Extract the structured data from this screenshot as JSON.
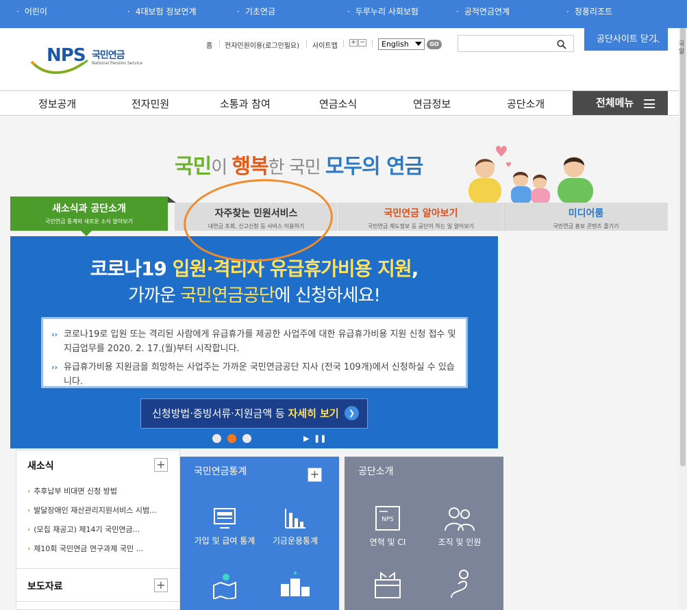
{
  "topbar": {
    "links": [
      "어린이",
      "4대보험 정보연계",
      "기초연금",
      "두루누리 사회보험",
      "공적연금연계",
      "청풍리조트"
    ]
  },
  "header": {
    "logo_brand": "NPS",
    "logo_name": "국민연금",
    "logo_sub": "National Pension Service",
    "util": {
      "home": "홈",
      "login": "전자민원이용(로그인필요)",
      "sitemap": "사이트맵",
      "zoom_in": "+",
      "zoom_out": "−"
    },
    "language": "English",
    "go_label": "GO",
    "search_placeholder": "",
    "close_sites_label": "공단사이트 닫기"
  },
  "side_cut_text": "국알",
  "gnb": {
    "items": [
      "정보공개",
      "전자민원",
      "소통과 참여",
      "연금소식",
      "연금정보",
      "공단소개"
    ],
    "all_menu_label": "전체메뉴"
  },
  "slogan": {
    "w1": "국민",
    "w2": "이 ",
    "w3": "행복",
    "w4": "한 국민 ",
    "w5": "모두의 연금"
  },
  "tabs": [
    {
      "title": "새소식과 공단소개",
      "sub": "국민연금 통계와 새로운 소식 알아보기",
      "color": "#ffffff"
    },
    {
      "title": "자주찾는 민원서비스",
      "sub": "내연금 조회, 신고신청 등 서비스 이용하기",
      "color": "#333333"
    },
    {
      "title": "국민연금 알아보기",
      "sub": "국민연금 제도정보 등 공단이 하는 일 알아보기",
      "color": "#e0501a"
    },
    {
      "title": "미디어룸",
      "sub": "국민연금 홍보 콘텐츠 즐기기",
      "color": "#2b79c9"
    }
  ],
  "banner": {
    "line1_a": "코로나19 ",
    "line1_b": "입원·격리자 유급휴가비용 지원",
    "line1_c": ",",
    "line2_a": "가까운 ",
    "line2_b": "국민연금공단",
    "line2_c": "에 신청하세요!",
    "bullet1": "코로나19로 입원 또는 격리된 사람에게 유급휴가를 제공한 사업주에 대한 유급휴가비용 지원 신청 접수 및 지급업무를 2020. 2. 17.(월)부터 시작합니다.",
    "bullet2": "유급휴가비용 지원금을 희망하는 사업주는 가까운 국민연금공단 지사 (전국 109개)에서 신청하실 수 있습니다.",
    "cta_a": "신청방법·증빙서류·지원금액 등 ",
    "cta_b": "자세히 보기",
    "slides_total": 3,
    "slide_active": 2
  },
  "news": {
    "title": "새소식",
    "items": [
      "추후납부 비대면 신청 방법",
      "발달장애인 재산관리지원서비스 시범...",
      "(모집 재공고) 제14기 국민연금...",
      "제10회 국민연금 연구과제 국민 ..."
    ],
    "press_title": "보도자료"
  },
  "stats_widget": {
    "title": "국민연금통계",
    "items": [
      "가입 및 급여 통계",
      "기금운용통계"
    ]
  },
  "about_widget": {
    "title": "공단소개",
    "items": [
      "연혁 및 CI",
      "조직 및 인원"
    ]
  }
}
